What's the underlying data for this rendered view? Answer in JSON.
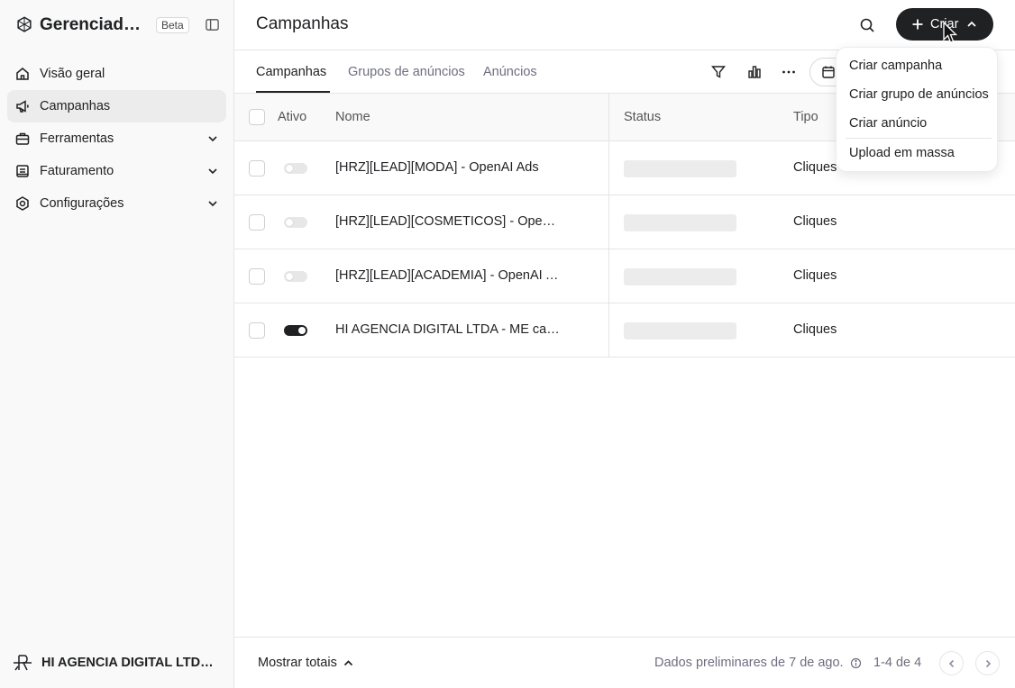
{
  "app": {
    "name": "Gerenciador ...",
    "badge": "Beta"
  },
  "sidebar": {
    "items": [
      {
        "label": "Visão geral",
        "icon": "home-icon"
      },
      {
        "label": "Campanhas",
        "icon": "megaphone-icon"
      },
      {
        "label": "Ferramentas",
        "icon": "briefcase-icon"
      },
      {
        "label": "Faturamento",
        "icon": "invoice-icon"
      },
      {
        "label": "Configurações",
        "icon": "gear-icon"
      }
    ],
    "active_index": 1,
    "account_name": "HI AGENCIA DIGITAL LTDA - ..."
  },
  "header": {
    "title": "Campanhas",
    "create_label": "Criar"
  },
  "tabs": [
    {
      "label": "Campanhas",
      "active": true
    },
    {
      "label": "Grupos de anúncios",
      "active": false
    },
    {
      "label": "Anúncios",
      "active": false
    }
  ],
  "table": {
    "columns": [
      "Ativo",
      "Nome",
      "Status",
      "Tipo"
    ],
    "rows": [
      {
        "active": false,
        "name": "[HRZ][LEAD][MODA] - OpenAI Ads",
        "type": "Cliques"
      },
      {
        "active": false,
        "name": "[HRZ][LEAD][COSMETICOS] - OpenA...",
        "type": "Cliques"
      },
      {
        "active": false,
        "name": "[HRZ][LEAD][ACADEMIA] - OpenAI Ads",
        "type": "Cliques"
      },
      {
        "active": true,
        "name": "HI AGENCIA DIGITAL LTDA - ME cam...",
        "type": "Cliques"
      }
    ]
  },
  "create_menu": {
    "items": [
      "Criar campanha",
      "Criar grupo de anúncios",
      "Criar anúncio",
      "Upload em massa"
    ]
  },
  "footer": {
    "totals_label": "Mostrar totais",
    "preliminary": "Dados preliminares de 7 de ago.",
    "page_info": "1-4 de 4"
  },
  "colors": {
    "accent": "#202123",
    "sidebar_bg": "#f9f9f9",
    "active_nav_bg": "#ececec",
    "skeleton": "#ececec"
  }
}
